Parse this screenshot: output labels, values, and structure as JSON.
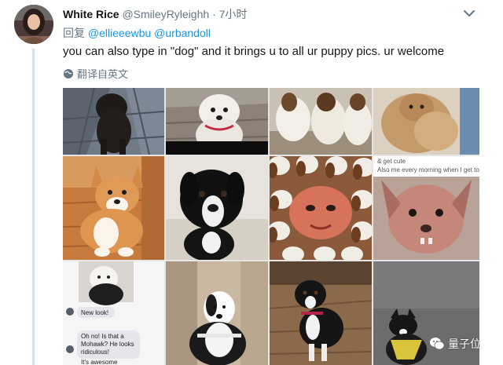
{
  "tweet": {
    "display_name": "White Rice",
    "handle": "@SmileyRyleighh",
    "separator": "·",
    "time": "7小时",
    "reply_prefix": "回复",
    "mentions": [
      "@ellieeewbu",
      "@urbandoll"
    ],
    "text": "you can also type in \"dog\" and it brings u to all ur puppy pics. ur welcome",
    "translate_label": "翻译自英文"
  },
  "grid": {
    "tile3_caption_1": "& get cute",
    "tile3_caption_2": "Also me every morning when I get to work:",
    "chat_new_look": "New look!",
    "chat_reply_1": "Oh no! Is that a",
    "chat_reply_2": "Mohawk? He looks",
    "chat_reply_3": "ridiculous!",
    "chat_footer": "It's awesome"
  },
  "watermark": {
    "text": "量子位"
  },
  "colors": {
    "link": "#1b95e0",
    "muted": "#657786",
    "thread_line": "#c4e4f3"
  }
}
